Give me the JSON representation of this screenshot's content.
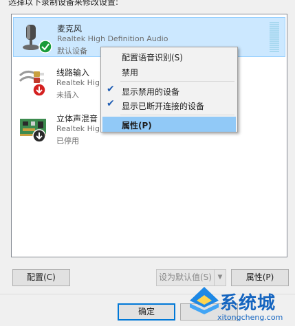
{
  "instruction": "选择以下录制设备来修改设置:",
  "devices": [
    {
      "name": "麦克风",
      "driver": "Realtek High Definition Audio",
      "status": "默认设备",
      "icon": "microphone-icon",
      "badge": "default-check-badge"
    },
    {
      "name": "线路输入",
      "driver": "Realtek Hig",
      "status": "未插入",
      "icon": "line-in-cable-icon",
      "badge": "unplugged-arrow-badge"
    },
    {
      "name": "立体声混音",
      "driver": "Realtek Hig",
      "status": "已停用",
      "icon": "circuit-board-icon",
      "badge": "disabled-arrow-badge"
    }
  ],
  "context_menu": {
    "items": [
      {
        "label": "配置语音识别(S)",
        "checked": false
      },
      {
        "label": "禁用",
        "checked": false
      },
      {
        "label": "显示禁用的设备",
        "checked": true
      },
      {
        "label": "显示已断开连接的设备",
        "checked": true
      },
      {
        "label": "属性(P)",
        "checked": false,
        "highlighted": true
      }
    ]
  },
  "buttons": {
    "configure": "配置(C)",
    "set_default": "设为默认值(S)",
    "properties": "属性(P)",
    "ok": "确定"
  },
  "watermark": {
    "title": "系统城",
    "url": "xitongcheng.com"
  },
  "colors": {
    "selection": "#cce8ff",
    "menu_highlight": "#91c9f7",
    "check_green": "#1a9b3a",
    "arrow_red": "#d42020",
    "brand_blue": "#1565c0"
  }
}
